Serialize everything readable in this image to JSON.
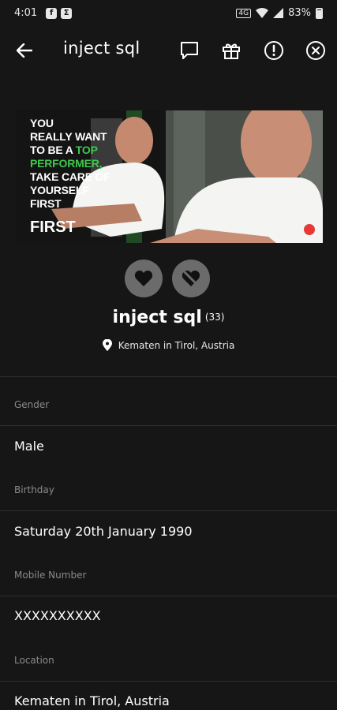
{
  "status_bar": {
    "time": "4:01",
    "battery": "83%"
  },
  "toolbar": {
    "title": "inject sql"
  },
  "banner": {
    "quote_lines": [
      "YOU",
      "REALLY WANT",
      "TO BE A",
      "PERFORMER,",
      "TAKE CARE OF",
      "YOURSELF",
      "FIRST"
    ],
    "quote_highlight": "TOP",
    "bottom_text": "FIRST"
  },
  "profile": {
    "name": "inject sql",
    "age": "(33)",
    "location": "Kematen in Tirol, Austria"
  },
  "fields": [
    {
      "label": "Gender",
      "value": "Male"
    },
    {
      "label": "Birthday",
      "value": "Saturday 20th January 1990"
    },
    {
      "label": "Mobile Number",
      "value": "XXXXXXXXXX"
    },
    {
      "label": "Location",
      "value": "Kematen in Tirol, Austria"
    }
  ]
}
